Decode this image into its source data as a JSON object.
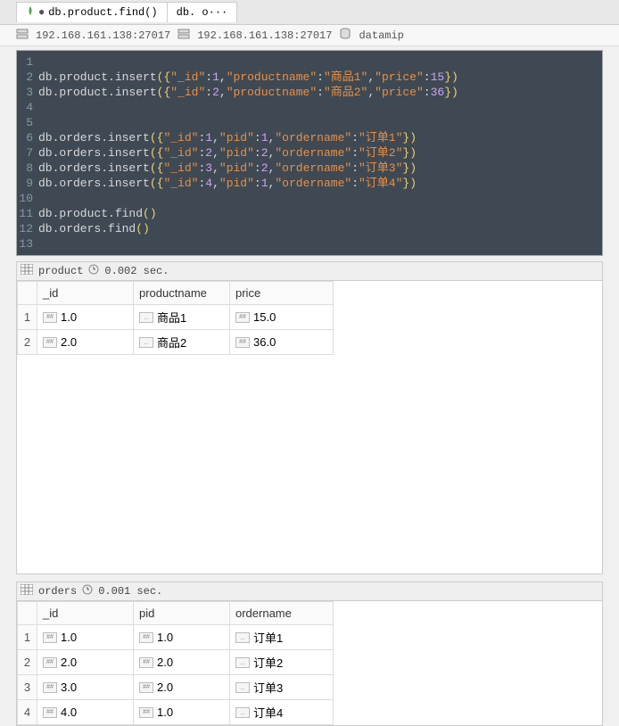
{
  "tabs": [
    {
      "label": "db.product.find()",
      "dirty": true
    },
    {
      "label": "db. o···",
      "dirty": false
    }
  ],
  "infobar": {
    "host1": "192.168.161.138:27017",
    "host2": "192.168.161.138:27017",
    "db": "datamip"
  },
  "editor_lines": [
    "",
    "db.product.insert({\"_id\":1,\"productname\":\"商品1\",\"price\":15})",
    "db.product.insert({\"_id\":2,\"productname\":\"商品2\",\"price\":36})",
    "",
    "",
    "db.orders.insert({\"_id\":1,\"pid\":1,\"ordername\":\"订单1\"})",
    "db.orders.insert({\"_id\":2,\"pid\":2,\"ordername\":\"订单2\"})",
    "db.orders.insert({\"_id\":3,\"pid\":2,\"ordername\":\"订单3\"})",
    "db.orders.insert({\"_id\":4,\"pid\":1,\"ordername\":\"订单4\"})",
    "",
    "db.product.find()",
    "db.orders.find()",
    ""
  ],
  "product": {
    "name": "product",
    "time": "0.002 sec.",
    "columns": [
      "_id",
      "productname",
      "price"
    ],
    "rows": [
      {
        "cells": [
          "1.0",
          "商品1",
          "15.0"
        ],
        "types": [
          "num",
          "str",
          "num"
        ]
      },
      {
        "cells": [
          "2.0",
          "商品2",
          "36.0"
        ],
        "types": [
          "num",
          "str",
          "num"
        ]
      }
    ]
  },
  "orders": {
    "name": "orders",
    "time": "0.001 sec.",
    "columns": [
      "_id",
      "pid",
      "ordername"
    ],
    "rows": [
      {
        "cells": [
          "1.0",
          "1.0",
          "订单1"
        ],
        "types": [
          "num",
          "num",
          "str"
        ]
      },
      {
        "cells": [
          "2.0",
          "2.0",
          "订单2"
        ],
        "types": [
          "num",
          "num",
          "str"
        ]
      },
      {
        "cells": [
          "3.0",
          "2.0",
          "订单3"
        ],
        "types": [
          "num",
          "num",
          "str"
        ]
      },
      {
        "cells": [
          "4.0",
          "1.0",
          "订单4"
        ],
        "types": [
          "num",
          "num",
          "str"
        ]
      }
    ]
  },
  "chart_data": [
    {
      "type": "table",
      "title": "product",
      "columns": [
        "_id",
        "productname",
        "price"
      ],
      "rows": [
        [
          1.0,
          "商品1",
          15.0
        ],
        [
          2.0,
          "商品2",
          36.0
        ]
      ]
    },
    {
      "type": "table",
      "title": "orders",
      "columns": [
        "_id",
        "pid",
        "ordername"
      ],
      "rows": [
        [
          1.0,
          1.0,
          "订单1"
        ],
        [
          2.0,
          2.0,
          "订单2"
        ],
        [
          3.0,
          2.0,
          "订单3"
        ],
        [
          4.0,
          1.0,
          "订单4"
        ]
      ]
    }
  ]
}
